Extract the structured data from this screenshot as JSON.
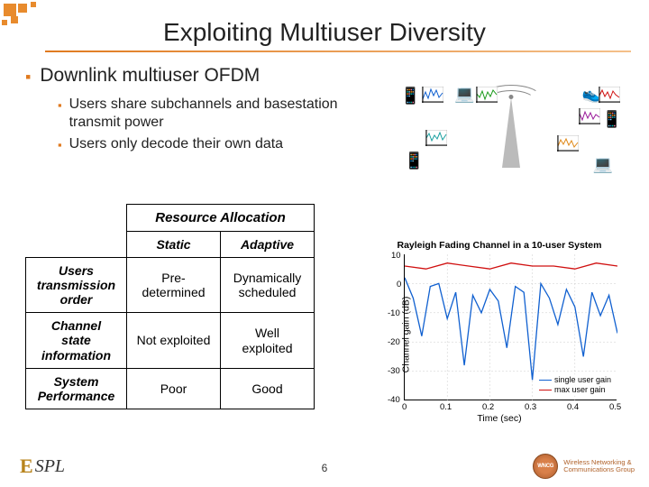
{
  "title": "Exploiting Multiuser Diversity",
  "bullets": {
    "main": "Downlink multiuser OFDM",
    "subs": [
      "Users share subchannels and basestation transmit power",
      "Users only decode their own data"
    ]
  },
  "table": {
    "span_header": "Resource Allocation",
    "cols": [
      "Static",
      "Adaptive"
    ],
    "rows": [
      {
        "label": "Users transmission order",
        "static": "Pre-determined",
        "adaptive": "Dynamically scheduled"
      },
      {
        "label": "Channel state information",
        "static": "Not exploited",
        "adaptive": "Well exploited"
      },
      {
        "label": "System Performance",
        "static": "Poor",
        "adaptive": "Good"
      }
    ]
  },
  "chart_data": {
    "type": "line",
    "title": "Rayleigh Fading Channel in a 10-user System",
    "xlabel": "Time (sec)",
    "ylabel": "Channel gain (dB)",
    "xlim": [
      0,
      0.5
    ],
    "ylim": [
      -40,
      10
    ],
    "xticks": [
      0,
      0.1,
      0.2,
      0.3,
      0.4,
      0.5
    ],
    "yticks": [
      -40,
      -30,
      -20,
      -10,
      0,
      10
    ],
    "legend": [
      "single user gain",
      "max user gain"
    ],
    "series": [
      {
        "name": "single user gain",
        "color": "#1060d0",
        "x": [
          0,
          0.02,
          0.04,
          0.06,
          0.08,
          0.1,
          0.12,
          0.14,
          0.16,
          0.18,
          0.2,
          0.22,
          0.24,
          0.26,
          0.28,
          0.3,
          0.32,
          0.34,
          0.36,
          0.38,
          0.4,
          0.42,
          0.44,
          0.46,
          0.48,
          0.5
        ],
        "y": [
          2,
          -5,
          -18,
          -1,
          0,
          -12,
          -3,
          -28,
          -4,
          -10,
          -2,
          -6,
          -22,
          -1,
          -3,
          -33,
          0,
          -5,
          -14,
          -2,
          -8,
          -25,
          -3,
          -11,
          -4,
          -17
        ]
      },
      {
        "name": "max user gain",
        "color": "#d01010",
        "x": [
          0,
          0.05,
          0.1,
          0.15,
          0.2,
          0.25,
          0.3,
          0.35,
          0.4,
          0.45,
          0.5
        ],
        "y": [
          6,
          5,
          7,
          6,
          5,
          7,
          6,
          6,
          5,
          7,
          6
        ]
      }
    ]
  },
  "page_number": "6",
  "logos": {
    "left": "ESPL",
    "right_lines": [
      "Wireless Networking &",
      "Communications Group"
    ]
  }
}
